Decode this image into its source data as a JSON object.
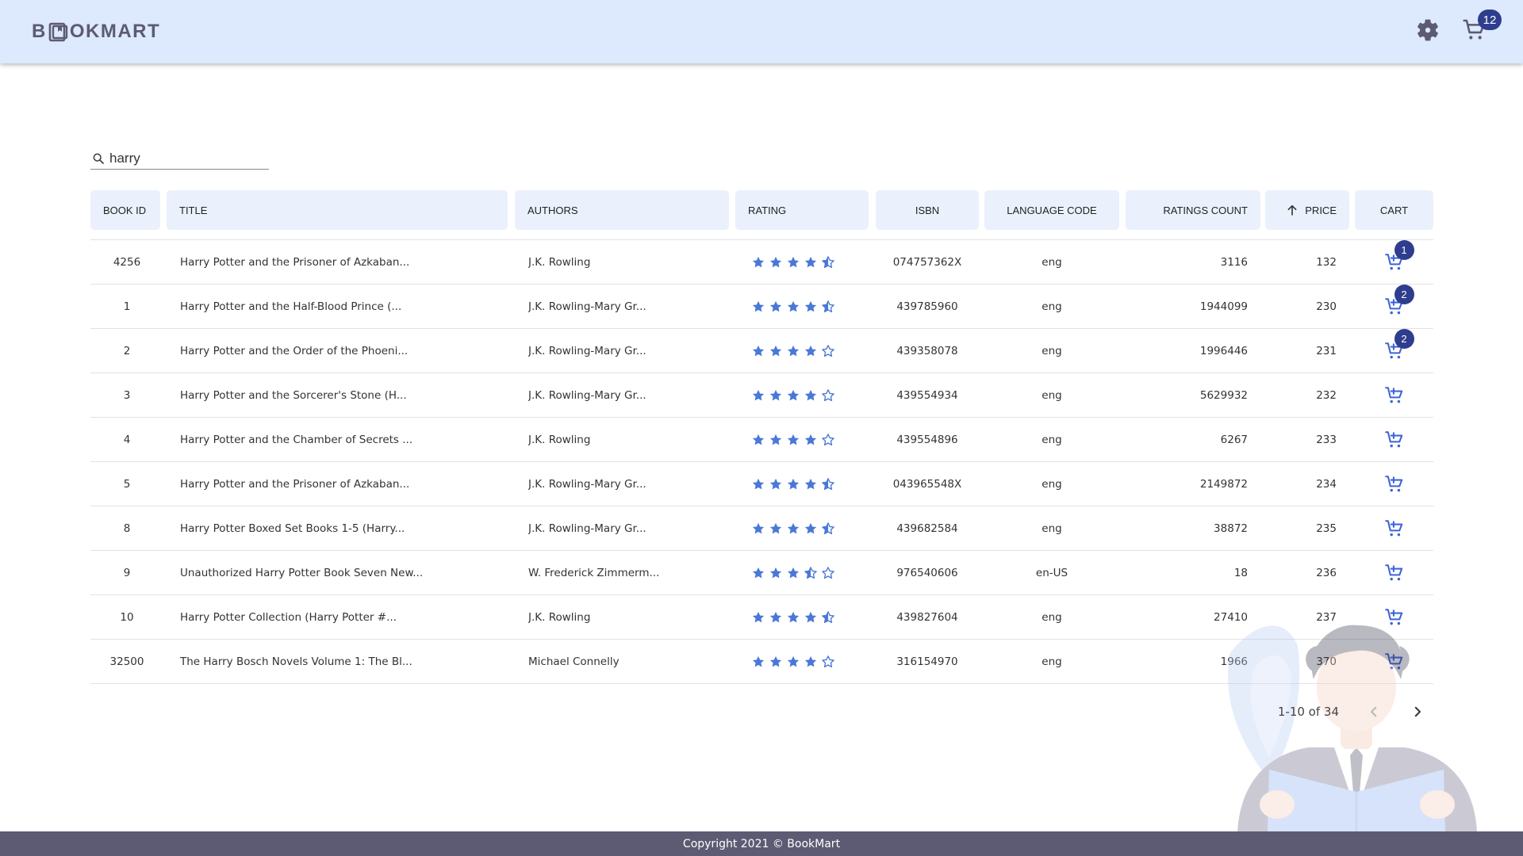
{
  "header": {
    "logo_prefix": "B",
    "logo_suffix": "OKMART",
    "cart_count": "12"
  },
  "search": {
    "value": "harry",
    "icon": "search-icon"
  },
  "table": {
    "columns": {
      "book_id": "BOOK ID",
      "title": "TITLE",
      "authors": "AUTHORS",
      "rating": "RATING",
      "isbn": "ISBN",
      "language_code": "LANGUAGE CODE",
      "ratings_count": "RATINGS COUNT",
      "price": "PRICE",
      "cart": "CART"
    },
    "sort": {
      "column": "price",
      "direction": "ascending"
    },
    "rows": [
      {
        "book_id": "4256",
        "title": "Harry Potter and the Prisoner of Azkaban...",
        "authors": "J.K. Rowling",
        "rating": 4.5,
        "isbn": "074757362X",
        "language_code": "eng",
        "ratings_count": "3116",
        "price": "132",
        "cart_qty": "1"
      },
      {
        "book_id": "1",
        "title": "Harry Potter and the Half-Blood Prince (...",
        "authors": "J.K. Rowling-Mary Gr...",
        "rating": 4.5,
        "isbn": "439785960",
        "language_code": "eng",
        "ratings_count": "1944099",
        "price": "230",
        "cart_qty": "2"
      },
      {
        "book_id": "2",
        "title": "Harry Potter and the Order of the Phoeni...",
        "authors": "J.K. Rowling-Mary Gr...",
        "rating": 4,
        "isbn": "439358078",
        "language_code": "eng",
        "ratings_count": "1996446",
        "price": "231",
        "cart_qty": "2"
      },
      {
        "book_id": "3",
        "title": "Harry Potter and the Sorcerer's Stone (H...",
        "authors": "J.K. Rowling-Mary Gr...",
        "rating": 4,
        "isbn": "439554934",
        "language_code": "eng",
        "ratings_count": "5629932",
        "price": "232",
        "cart_qty": ""
      },
      {
        "book_id": "4",
        "title": "Harry Potter and the Chamber of Secrets ...",
        "authors": "J.K. Rowling",
        "rating": 4,
        "isbn": "439554896",
        "language_code": "eng",
        "ratings_count": "6267",
        "price": "233",
        "cart_qty": ""
      },
      {
        "book_id": "5",
        "title": "Harry Potter and the Prisoner of Azkaban...",
        "authors": "J.K. Rowling-Mary Gr...",
        "rating": 4.5,
        "isbn": "043965548X",
        "language_code": "eng",
        "ratings_count": "2149872",
        "price": "234",
        "cart_qty": ""
      },
      {
        "book_id": "8",
        "title": "Harry Potter Boxed Set Books 1-5 (Harry...",
        "authors": "J.K. Rowling-Mary Gr...",
        "rating": 4.5,
        "isbn": "439682584",
        "language_code": "eng",
        "ratings_count": "38872",
        "price": "235",
        "cart_qty": ""
      },
      {
        "book_id": "9",
        "title": "Unauthorized Harry Potter Book Seven New...",
        "authors": "W. Frederick Zimmerm...",
        "rating": 3.5,
        "isbn": "976540606",
        "language_code": "en-US",
        "ratings_count": "18",
        "price": "236",
        "cart_qty": ""
      },
      {
        "book_id": "10",
        "title": "Harry Potter Collection (Harry Potter #...",
        "authors": "J.K. Rowling",
        "rating": 4.5,
        "isbn": "439827604",
        "language_code": "eng",
        "ratings_count": "27410",
        "price": "237",
        "cart_qty": ""
      },
      {
        "book_id": "32500",
        "title": "The Harry Bosch Novels Volume 1: The Bl...",
        "authors": "Michael Connelly",
        "rating": 4,
        "isbn": "316154970",
        "language_code": "eng",
        "ratings_count": "1966",
        "price": "370",
        "cart_qty": ""
      }
    ]
  },
  "pagination": {
    "range": "1-10 of 34"
  },
  "footer": {
    "copyright": "Copyright 2021 © BookMart"
  },
  "colors": {
    "header_bg": "#dde9fc",
    "header_cell_bg": "#eaf1fc",
    "accent": "#3d64d8",
    "star": "#4a78d8",
    "badge": "#2f3d8e",
    "brand_text": "#5c5b73",
    "footer_bg": "#5c5b73"
  },
  "icons": {
    "settings": "gear-icon",
    "header_cart": "shopping-cart-icon",
    "row_cart": "add-to-cart-icon",
    "sort": "arrow-up-icon",
    "prev": "chevron-left-icon",
    "next": "chevron-right-icon"
  }
}
